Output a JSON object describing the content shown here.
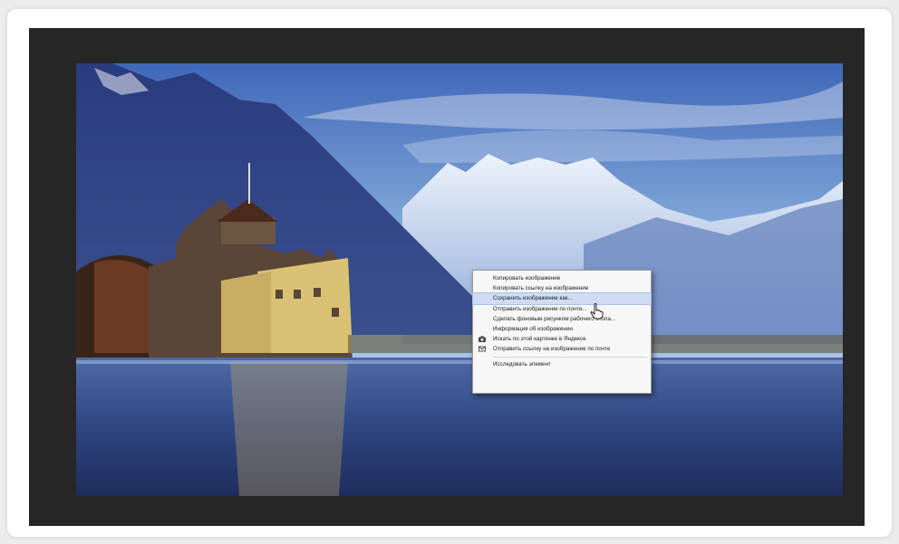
{
  "context_menu": {
    "items": [
      {
        "label": "Копировать изображение"
      },
      {
        "label": "Копировать ссылку на изображение"
      },
      {
        "label": "Сохранить изображение как...",
        "highlighted": true
      },
      {
        "label": "Отправить изображение по почте..."
      },
      {
        "label": "Сделать фоновым рисунком рабочего стола..."
      },
      {
        "label": "Информация об изображении"
      },
      {
        "label": "Искать по этой картинке в Яндексе",
        "icon": "camera-icon"
      },
      {
        "label": "Отправить ссылку на изображение по почте",
        "icon": "mail-icon"
      },
      {
        "label": "Исследовать элемент"
      }
    ]
  },
  "colors": {
    "menu_highlight": "#cfdcf3",
    "screen_frame": "#262626",
    "card_background": "#ffffff"
  }
}
